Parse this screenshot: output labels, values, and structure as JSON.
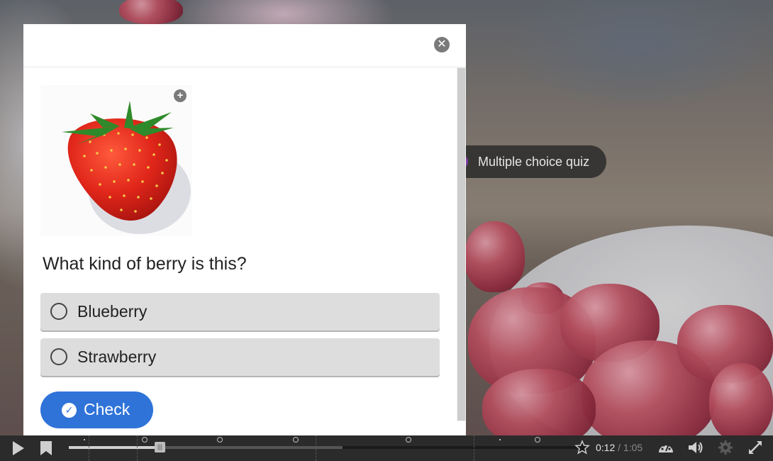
{
  "video": {
    "hotspot_label": "Multiple choice quiz"
  },
  "dialog": {
    "close_icon": "close-icon",
    "image_zoom_icon": "zoom-plus-icon",
    "question": "What kind of berry is this?",
    "answers": [
      {
        "label": "Blueberry"
      },
      {
        "label": "Strawberry"
      }
    ],
    "check_label": "Check",
    "check_icon": "check-circle-icon"
  },
  "controls": {
    "play_icon": "play-icon",
    "bookmark_icon": "bookmark-icon",
    "current_time": "0:12",
    "separator": "/",
    "total_time": "1:05",
    "progress": 0.185,
    "star_icon": "star-icon",
    "speed_icon": "speedometer-icon",
    "volume_icon": "volume-icon",
    "settings_icon": "gear-icon",
    "fullscreen_icon": "fullscreen-icon"
  },
  "colors": {
    "accent": "#2f73d9",
    "hotspot_dot": "#7c3fa8",
    "controls_bg": "#2b2b2b"
  }
}
